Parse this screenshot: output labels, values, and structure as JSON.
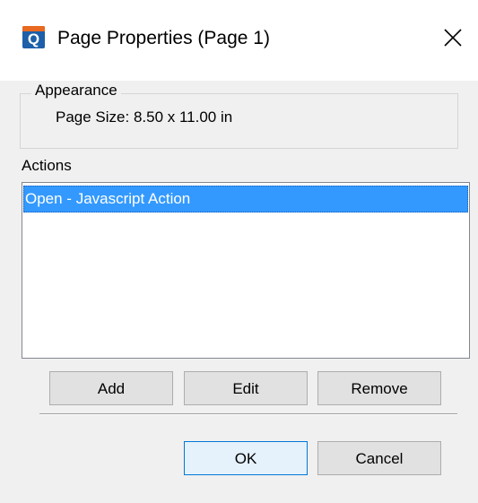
{
  "window": {
    "title": "Page Properties (Page 1)",
    "icon": "app-q-icon",
    "icon_glyph": "Q",
    "close_icon": "close-icon"
  },
  "appearance": {
    "legend": "Appearance",
    "page_size": "Page Size: 8.50 x 11.00 in"
  },
  "actions": {
    "label": "Actions",
    "items": [
      {
        "label": "Open - Javascript Action",
        "selected": true
      }
    ]
  },
  "action_buttons": {
    "add": "Add",
    "edit": "Edit",
    "remove": "Remove"
  },
  "dialog_buttons": {
    "ok": "OK",
    "cancel": "Cancel"
  },
  "colors": {
    "selection": "#3399ff",
    "default_button_border": "#0078d7",
    "app_icon_blue": "#1d5fa8",
    "app_icon_orange": "#e8691f"
  }
}
